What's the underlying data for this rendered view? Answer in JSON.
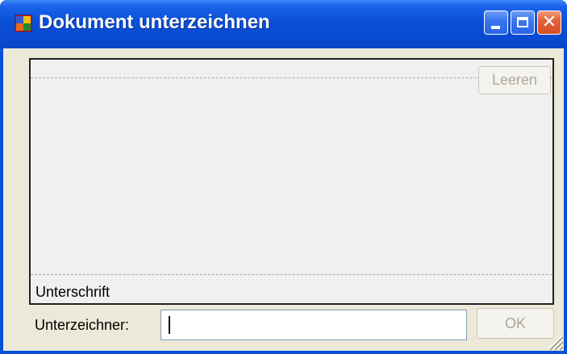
{
  "window": {
    "title": "Dokument unterzeichnen",
    "icon": "app-window-icon",
    "controls": {
      "minimize_icon": "minimize-icon",
      "maximize_icon": "maximize-icon",
      "close_icon": "close-icon",
      "close_glyph": "✕"
    },
    "colors": {
      "titlebar": "#0a4fd8",
      "client_background": "#ece9d8",
      "close_button": "#e4633c"
    }
  },
  "signature_pad": {
    "clear_label": "Leeren",
    "clear_enabled": false,
    "caption": "Unterschrift"
  },
  "signer": {
    "label": "Unterzeichner:",
    "value": "",
    "placeholder": ""
  },
  "ok_button": {
    "label": "OK",
    "enabled": false
  },
  "resize_grip_icon": "resize-grip-icon"
}
